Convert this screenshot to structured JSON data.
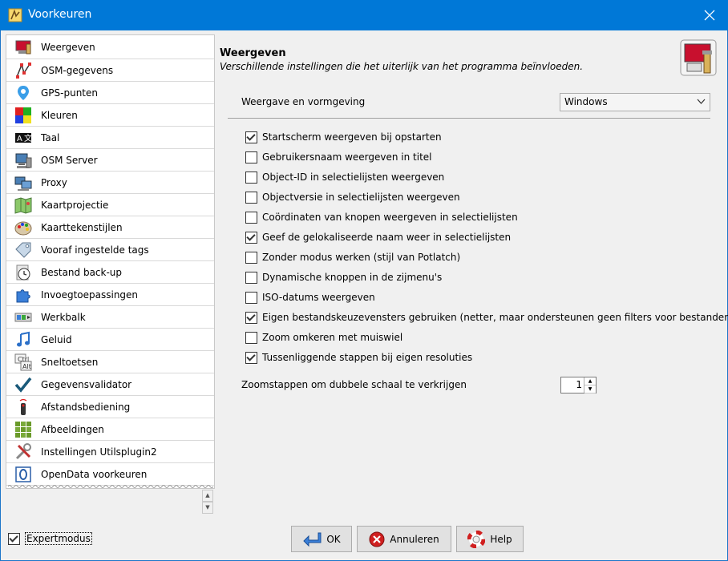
{
  "window": {
    "title": "Voorkeuren"
  },
  "sidebar": {
    "items": [
      {
        "label": "Weergeven",
        "icon": "display-icon",
        "selected": true
      },
      {
        "label": "OSM-gegevens",
        "icon": "osm-data-icon"
      },
      {
        "label": "GPS-punten",
        "icon": "gps-pin-icon"
      },
      {
        "label": "Kleuren",
        "icon": "colors-icon"
      },
      {
        "label": "Taal",
        "icon": "language-icon"
      },
      {
        "label": "OSM Server",
        "icon": "server-icon"
      },
      {
        "label": "Proxy",
        "icon": "proxy-icon"
      },
      {
        "label": "Kaartprojectie",
        "icon": "map-projection-icon"
      },
      {
        "label": "Kaarttekenstijlen",
        "icon": "palette-icon"
      },
      {
        "label": "Vooraf ingestelde tags",
        "icon": "tag-icon"
      },
      {
        "label": "Bestand back-up",
        "icon": "clock-backup-icon"
      },
      {
        "label": "Invoegtoepassingen",
        "icon": "puzzle-icon"
      },
      {
        "label": "Werkbalk",
        "icon": "toolbar-icon"
      },
      {
        "label": "Geluid",
        "icon": "music-note-icon"
      },
      {
        "label": "Sneltoetsen",
        "icon": "keyboard-shortcut-icon"
      },
      {
        "label": "Gegevensvalidator",
        "icon": "checkmark-icon"
      },
      {
        "label": "Afstandsbediening",
        "icon": "remote-control-icon"
      },
      {
        "label": "Afbeeldingen",
        "icon": "imagery-grid-icon"
      },
      {
        "label": "Instellingen Utilsplugin2",
        "icon": "tools-icon"
      },
      {
        "label": "OpenData voorkeuren",
        "icon": "opendata-icon"
      }
    ]
  },
  "main": {
    "heading": "Weergeven",
    "subheading": "Verschillende instellingen die het uiterlijk van het programma beïnvloeden.",
    "look_label": "Weergave en vormgeving",
    "look_value": "Windows",
    "checkboxes": [
      {
        "label": "Startscherm weergeven bij opstarten",
        "checked": true
      },
      {
        "label": "Gebruikersnaam weergeven in titel",
        "checked": false
      },
      {
        "label": "Object-ID in selectielijsten weergeven",
        "checked": false
      },
      {
        "label": "Objectversie in selectielijsten weergeven",
        "checked": false
      },
      {
        "label": "Coördinaten van knopen weergeven in selectielijsten",
        "checked": false
      },
      {
        "label": "Geef de gelokaliseerde naam weer in selectielijsten",
        "checked": true
      },
      {
        "label": "Zonder modus werken (stijl van Potlatch)",
        "checked": false
      },
      {
        "label": "Dynamische knoppen in de zijmenu's",
        "checked": false
      },
      {
        "label": "ISO-datums weergeven",
        "checked": false
      },
      {
        "label": "Eigen bestandskeuzevensters gebruiken (netter, maar ondersteunen geen filters voor bestanden)",
        "checked": true
      },
      {
        "label": "Zoom omkeren met muiswiel",
        "checked": false
      },
      {
        "label": "Tussenliggende stappen bij eigen resoluties",
        "checked": true
      }
    ],
    "zoom_label": "Zoomstappen om dubbele schaal te verkrijgen",
    "zoom_value": "1"
  },
  "footer": {
    "expert_label": "Expertmodus",
    "expert_checked": true,
    "ok_label": "OK",
    "cancel_label": "Annuleren",
    "help_label": "Help"
  },
  "colors": {
    "titlebar": "#0078d7",
    "accent": "#1c75c9"
  }
}
